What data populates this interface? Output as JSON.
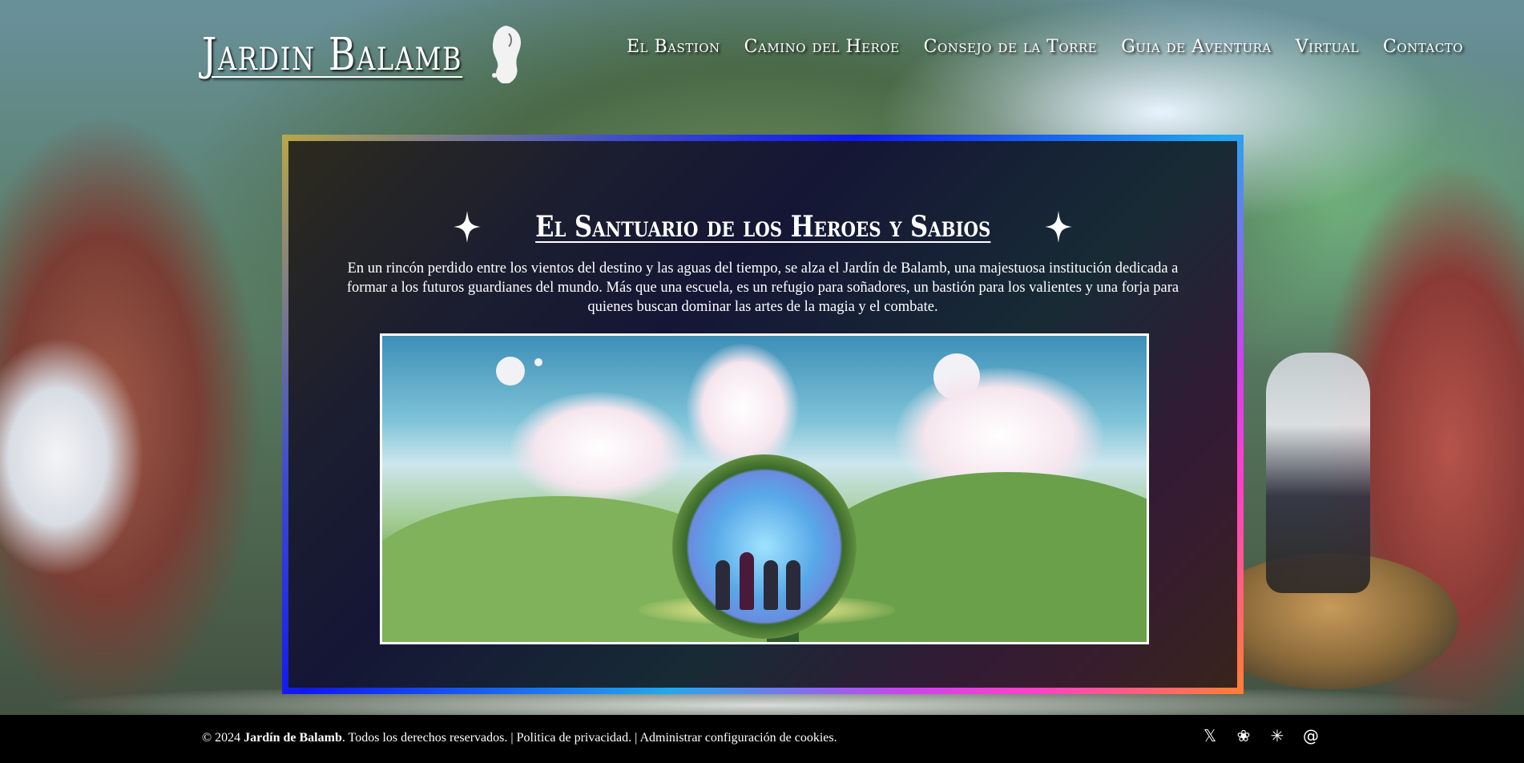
{
  "site": {
    "logo_text": "Jardin Balamb"
  },
  "nav": {
    "items": [
      {
        "label": "El Bastion"
      },
      {
        "label": "Camino del Heroe"
      },
      {
        "label": "Consejo de la Torre"
      },
      {
        "label": "Guia de Aventura"
      },
      {
        "label": "Virtual"
      },
      {
        "label": "Contacto"
      }
    ]
  },
  "main": {
    "title": "El Santuario de los Heroes y Sabios",
    "intro": "En un rincón perdido entre los vientos del destino y las aguas del tiempo, se alza el Jardín de Balamb, una majestuosa institución dedicada a formar a los futuros guardianes del mundo. Más que una escuela, es un refugio para soñadores, un bastión para los valientes y una forja para quienes buscan dominar las artes de la magia y el combate."
  },
  "footer": {
    "copyright_prefix": "© 2024",
    "org_name": "Jardín de Balamb",
    "rights": ". Todos los derechos reservados. |",
    "privacy": "Politica de privacidad.",
    "separator": "|",
    "cookies": "Administrar configuración de cookies."
  },
  "socials": [
    {
      "icon": "x-icon",
      "glyph": "𝕏"
    },
    {
      "icon": "raspberry-icon",
      "glyph": "❀"
    },
    {
      "icon": "asterisk-icon",
      "glyph": "✳"
    },
    {
      "icon": "threads-icon",
      "glyph": "@"
    }
  ],
  "colors": {
    "panel_border_gradient": [
      "#b8a848",
      "#1018f0",
      "#20a8f0",
      "#ff40c8",
      "#ff8030"
    ],
    "panel_bg": "#161616",
    "footer_bg": "#000000"
  }
}
